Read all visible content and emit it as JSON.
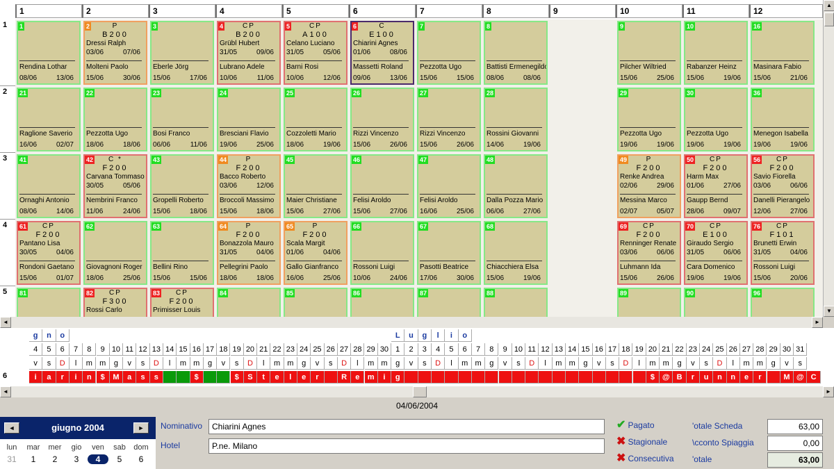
{
  "columns": [
    "1",
    "2",
    "3",
    "4",
    "5",
    "6",
    "7",
    "8",
    "9",
    "10",
    "11",
    "12"
  ],
  "rows": [
    "1",
    "2",
    "3",
    "4",
    "5"
  ],
  "cells": [
    {
      "r": 0,
      "c": 0,
      "num": "1",
      "st": "g",
      "l1": "",
      "l1a": "",
      "l1b": "",
      "l2": "Rendina Lothar",
      "l2a": "08/06",
      "l2b": "13/06"
    },
    {
      "r": 0,
      "c": 1,
      "num": "2",
      "st": "o",
      "type": "P",
      "code": "B200",
      "l1": "Dressi Ralph",
      "l1a": "03/06",
      "l1b": "07/06",
      "l2": "Molteni Paolo",
      "l2a": "15/06",
      "l2b": "30/06"
    },
    {
      "r": 0,
      "c": 2,
      "num": "3",
      "st": "g",
      "l2": "Eberle Jörg",
      "l2a": "15/06",
      "l2b": "17/06"
    },
    {
      "r": 0,
      "c": 3,
      "num": "4",
      "st": "r",
      "type": "CP",
      "code": "B200",
      "l1": "Grübl Hubert",
      "l1a": "31/05",
      "l1b": "09/06",
      "l2": "Lubrano Adele",
      "l2a": "10/06",
      "l2b": "11/06"
    },
    {
      "r": 0,
      "c": 4,
      "num": "5",
      "st": "r",
      "type": "CP",
      "code": "A100",
      "l1": "Celano Luciano",
      "l1a": "31/05",
      "l1b": "05/06",
      "l2": "Barni Rosi",
      "l2a": "10/06",
      "l2b": "12/06"
    },
    {
      "r": 0,
      "c": 5,
      "num": "6",
      "st": "s",
      "type": "C",
      "code": "E100",
      "l1": "Chiarini Agnes",
      "l1a": "01/06",
      "l1b": "08/06",
      "l2": "Massetti Roland",
      "l2a": "09/06",
      "l2b": "13/06"
    },
    {
      "r": 0,
      "c": 6,
      "num": "7",
      "st": "g",
      "l2": "Pezzotta Ugo",
      "l2a": "15/06",
      "l2b": "15/06"
    },
    {
      "r": 0,
      "c": 7,
      "num": "8",
      "st": "g",
      "l2": "Battisti Ermenegildo",
      "l2a": "08/06",
      "l2b": "08/06"
    },
    {
      "r": 0,
      "c": 9,
      "num": "9",
      "st": "g",
      "l2": "Pilcher Wiltried",
      "l2a": "15/06",
      "l2b": "25/06"
    },
    {
      "r": 0,
      "c": 10,
      "num": "10",
      "st": "g",
      "l2": "Rabanzer Heinz",
      "l2a": "15/06",
      "l2b": "19/06"
    },
    {
      "r": 0,
      "c": 11,
      "num": "16",
      "st": "g",
      "l2": "Masinara Fabio",
      "l2a": "15/06",
      "l2b": "21/06"
    },
    {
      "r": 1,
      "c": 0,
      "num": "21",
      "st": "g",
      "l2": "Raglione Saverio",
      "l2a": "16/06",
      "l2b": "02/07"
    },
    {
      "r": 1,
      "c": 1,
      "num": "22",
      "st": "g",
      "l2": "Pezzotta Ugo",
      "l2a": "18/06",
      "l2b": "18/06"
    },
    {
      "r": 1,
      "c": 2,
      "num": "23",
      "st": "g",
      "l2": "Bosi Franco",
      "l2a": "06/06",
      "l2b": "11/06"
    },
    {
      "r": 1,
      "c": 3,
      "num": "24",
      "st": "g",
      "l2": "Bresciani Flavio",
      "l2a": "19/06",
      "l2b": "25/06"
    },
    {
      "r": 1,
      "c": 4,
      "num": "25",
      "st": "g",
      "l2": "Cozzoletti Mario",
      "l2a": "18/06",
      "l2b": "19/06"
    },
    {
      "r": 1,
      "c": 5,
      "num": "26",
      "st": "g",
      "l2": "Rizzi Vincenzo",
      "l2a": "15/06",
      "l2b": "26/06"
    },
    {
      "r": 1,
      "c": 6,
      "num": "27",
      "st": "g",
      "l2": "Rizzi Vincenzo",
      "l2a": "15/06",
      "l2b": "26/06"
    },
    {
      "r": 1,
      "c": 7,
      "num": "28",
      "st": "g",
      "l2": "Rossini Giovanni",
      "l2a": "14/06",
      "l2b": "19/06"
    },
    {
      "r": 1,
      "c": 9,
      "num": "29",
      "st": "g",
      "l2": "Pezzotta Ugo",
      "l2a": "19/06",
      "l2b": "19/06"
    },
    {
      "r": 1,
      "c": 10,
      "num": "30",
      "st": "g",
      "l2": "Pezzotta Ugo",
      "l2a": "19/06",
      "l2b": "19/06"
    },
    {
      "r": 1,
      "c": 11,
      "num": "36",
      "st": "g",
      "l2": "Menegon Isabella",
      "l2a": "19/06",
      "l2b": "19/06"
    },
    {
      "r": 2,
      "c": 0,
      "num": "41",
      "st": "g",
      "l2": "Ornaghi Antonio",
      "l2a": "08/06",
      "l2b": "14/06"
    },
    {
      "r": 2,
      "c": 1,
      "num": "42",
      "st": "r",
      "type": "C *",
      "code": "F200",
      "l1": "Carvana Tommaso",
      "l1a": "30/05",
      "l1b": "05/06",
      "l2": "Nembrini Franco",
      "l2a": "11/06",
      "l2b": "24/06"
    },
    {
      "r": 2,
      "c": 2,
      "num": "43",
      "st": "g",
      "l2": "Gropelli Roberto",
      "l2a": "15/06",
      "l2b": "18/06"
    },
    {
      "r": 2,
      "c": 3,
      "num": "44",
      "st": "o",
      "type": "P",
      "code": "F200",
      "l1": "Bacco Roberto",
      "l1a": "03/06",
      "l1b": "12/06",
      "l2": "Broccoli Massimo",
      "l2a": "15/06",
      "l2b": "18/06"
    },
    {
      "r": 2,
      "c": 4,
      "num": "45",
      "st": "g",
      "l2": "Maier Christiane",
      "l2a": "15/06",
      "l2b": "27/06"
    },
    {
      "r": 2,
      "c": 5,
      "num": "46",
      "st": "g",
      "l2": "Felisi Aroldo",
      "l2a": "15/06",
      "l2b": "27/06"
    },
    {
      "r": 2,
      "c": 6,
      "num": "47",
      "st": "g",
      "l2": "Felisi Aroldo",
      "l2a": "16/06",
      "l2b": "25/06"
    },
    {
      "r": 2,
      "c": 7,
      "num": "48",
      "st": "g",
      "l2": "Dalla Pozza Mario",
      "l2a": "06/06",
      "l2b": "27/06"
    },
    {
      "r": 2,
      "c": 9,
      "num": "49",
      "st": "o",
      "type": "P",
      "code": "F200",
      "l1": "Renke Andrea",
      "l1a": "02/06",
      "l1b": "29/06",
      "l2": "Messina Marco",
      "l2a": "02/07",
      "l2b": "05/07"
    },
    {
      "r": 2,
      "c": 10,
      "num": "50",
      "st": "r",
      "type": "CP",
      "code": "F200",
      "l1": "Harm Max",
      "l1a": "01/06",
      "l1b": "27/06",
      "l2": "Gaupp Bernd",
      "l2a": "28/06",
      "l2b": "09/07"
    },
    {
      "r": 2,
      "c": 11,
      "num": "56",
      "st": "r",
      "type": "CP",
      "code": "F200",
      "l1": "Savio Fiorella",
      "l1a": "03/06",
      "l1b": "06/06",
      "l2": "Danelli Pierangelo",
      "l2a": "12/06",
      "l2b": "27/06"
    },
    {
      "r": 3,
      "c": 0,
      "num": "61",
      "st": "r",
      "type": "CP",
      "code": "F200",
      "l1": "Pantano Lisa",
      "l1a": "30/05",
      "l1b": "04/06",
      "l2": "Rondoni Gaetano",
      "l2a": "15/06",
      "l2b": "01/07"
    },
    {
      "r": 3,
      "c": 1,
      "num": "62",
      "st": "g",
      "l2": "Giovagnoni Roger",
      "l2a": "18/06",
      "l2b": "25/06"
    },
    {
      "r": 3,
      "c": 2,
      "num": "63",
      "st": "g",
      "l2": "Bellini Rino",
      "l2a": "15/06",
      "l2b": "15/06"
    },
    {
      "r": 3,
      "c": 3,
      "num": "64",
      "st": "o",
      "type": "P",
      "code": "F200",
      "l1": "Bonazzola Mauro",
      "l1a": "31/05",
      "l1b": "04/06",
      "l2": "Pellegrini Paolo",
      "l2a": "18/06",
      "l2b": "18/06"
    },
    {
      "r": 3,
      "c": 4,
      "num": "65",
      "st": "o",
      "type": "P",
      "code": "F200",
      "l1": "Scala Margit",
      "l1a": "01/06",
      "l1b": "04/06",
      "l2": "Gallo Gianfranco",
      "l2a": "16/06",
      "l2b": "25/06"
    },
    {
      "r": 3,
      "c": 5,
      "num": "66",
      "st": "g",
      "l2": "Rossoni Luigi",
      "l2a": "10/06",
      "l2b": "24/06"
    },
    {
      "r": 3,
      "c": 6,
      "num": "67",
      "st": "g",
      "l2": "Pasotti Beatrice",
      "l2a": "17/06",
      "l2b": "30/06"
    },
    {
      "r": 3,
      "c": 7,
      "num": "68",
      "st": "g",
      "l2": "Chiacchiera Elsa",
      "l2a": "15/06",
      "l2b": "19/06"
    },
    {
      "r": 3,
      "c": 9,
      "num": "69",
      "st": "r",
      "type": "CP",
      "code": "F200",
      "l1": "Renninger Renate",
      "l1a": "03/06",
      "l1b": "06/06",
      "l2": "Luhmann Ida",
      "l2a": "15/06",
      "l2b": "26/06"
    },
    {
      "r": 3,
      "c": 10,
      "num": "70",
      "st": "r",
      "type": "CP",
      "code": "E100",
      "l1": "Giraudo Sergio",
      "l1a": "31/05",
      "l1b": "06/06",
      "l2": "Cara Domenico",
      "l2a": "19/06",
      "l2b": "19/06"
    },
    {
      "r": 3,
      "c": 11,
      "num": "76",
      "st": "r",
      "type": "CP",
      "code": "F101",
      "l1": "Brunetti Erwin",
      "l1a": "31/05",
      "l1b": "04/06",
      "l2": "Rossoni Luigi",
      "l2a": "15/06",
      "l2b": "20/06"
    },
    {
      "r": 4,
      "c": 0,
      "num": "81",
      "st": "g"
    },
    {
      "r": 4,
      "c": 1,
      "num": "82",
      "st": "r",
      "type": "CP",
      "code": "F300",
      "l1": "Rossi Carlo"
    },
    {
      "r": 4,
      "c": 2,
      "num": "83",
      "st": "r",
      "type": "CP",
      "code": "F200",
      "l1": "Primisser Louis"
    },
    {
      "r": 4,
      "c": 3,
      "num": "84",
      "st": "g"
    },
    {
      "r": 4,
      "c": 4,
      "num": "85",
      "st": "g"
    },
    {
      "r": 4,
      "c": 5,
      "num": "86",
      "st": "g"
    },
    {
      "r": 4,
      "c": 6,
      "num": "87",
      "st": "g"
    },
    {
      "r": 4,
      "c": 7,
      "num": "88",
      "st": "g"
    },
    {
      "r": 4,
      "c": 9,
      "num": "89",
      "st": "g"
    },
    {
      "r": 4,
      "c": 10,
      "num": "90",
      "st": "g"
    },
    {
      "r": 4,
      "c": 11,
      "num": "96",
      "st": "g"
    }
  ],
  "strip": {
    "month_june": [
      "g",
      "n",
      "o"
    ],
    "month_july": [
      "L",
      "u",
      "g",
      "l",
      "i",
      "o"
    ],
    "days": [
      "4",
      "5",
      "6",
      "7",
      "8",
      "9",
      "10",
      "11",
      "12",
      "13",
      "14",
      "15",
      "16",
      "17",
      "18",
      "19",
      "20",
      "21",
      "22",
      "23",
      "24",
      "25",
      "26",
      "27",
      "28",
      "29",
      "30",
      "1",
      "2",
      "3",
      "4",
      "5",
      "6",
      "7",
      "8",
      "9",
      "10",
      "11",
      "12",
      "13",
      "14",
      "15",
      "16",
      "17",
      "18",
      "19",
      "20",
      "21",
      "22",
      "23",
      "24",
      "25",
      "26",
      "27",
      "28",
      "29",
      "30",
      "31"
    ],
    "weekdays": [
      "v",
      "s",
      "D",
      "l",
      "m",
      "m",
      "g",
      "v",
      "s",
      "D",
      "l",
      "m",
      "m",
      "g",
      "v",
      "s",
      "D",
      "l",
      "m",
      "m",
      "g",
      "v",
      "s",
      "D",
      "l",
      "m",
      "m",
      "g",
      "v",
      "s",
      "D",
      "l",
      "m",
      "m",
      "g",
      "v",
      "s",
      "D",
      "l",
      "m",
      "m",
      "g",
      "v",
      "s",
      "D",
      "l",
      "m",
      "m",
      "g",
      "v",
      "s",
      "D",
      "l",
      "m",
      "m",
      "g",
      "v",
      "s"
    ],
    "row_label": "6",
    "events": [
      "i",
      "a",
      "r",
      "i",
      "n",
      "$",
      "M",
      "a",
      "s",
      "s",
      "",
      "",
      "$",
      "",
      "",
      "$",
      "S",
      "t",
      "e",
      "l",
      "e",
      "r",
      "",
      "R",
      "e",
      "m",
      "i",
      "g",
      "",
      "",
      "",
      "",
      "",
      "",
      "",
      "",
      "",
      "",
      "",
      "",
      "",
      "",
      "",
      "",
      "",
      "",
      "$",
      "@",
      "B",
      "r",
      "u",
      "n",
      "n",
      "e",
      "r",
      "",
      "M",
      "@",
      "C"
    ],
    "green_cells": [
      10,
      11,
      13,
      14
    ]
  },
  "date_label": "04/06/2004",
  "minical": {
    "title": "giugno 2004",
    "prev": "◄",
    "next": "►",
    "dows": [
      "lun",
      "mar",
      "mer",
      "gio",
      "ven",
      "sab",
      "dom"
    ],
    "days": [
      "31",
      "1",
      "2",
      "3",
      "4",
      "5",
      "6"
    ]
  },
  "form": {
    "nominativo_label": "Nominativo",
    "nominativo_value": "Chiarini Agnes",
    "hotel_label": "Hotel",
    "hotel_value": "P.ne. Milano"
  },
  "status": {
    "pagato": "Pagato",
    "stagionale": "Stagionale",
    "consecutiva": "Consecutiva"
  },
  "totals": {
    "totale_scheda_label": "'otale Scheda",
    "totale_scheda_value": "63,00",
    "acconto_label": "\\cconto Spiaggia",
    "acconto_value": "0,00",
    "totale_label": "'otale",
    "totale_value": "63,00"
  }
}
